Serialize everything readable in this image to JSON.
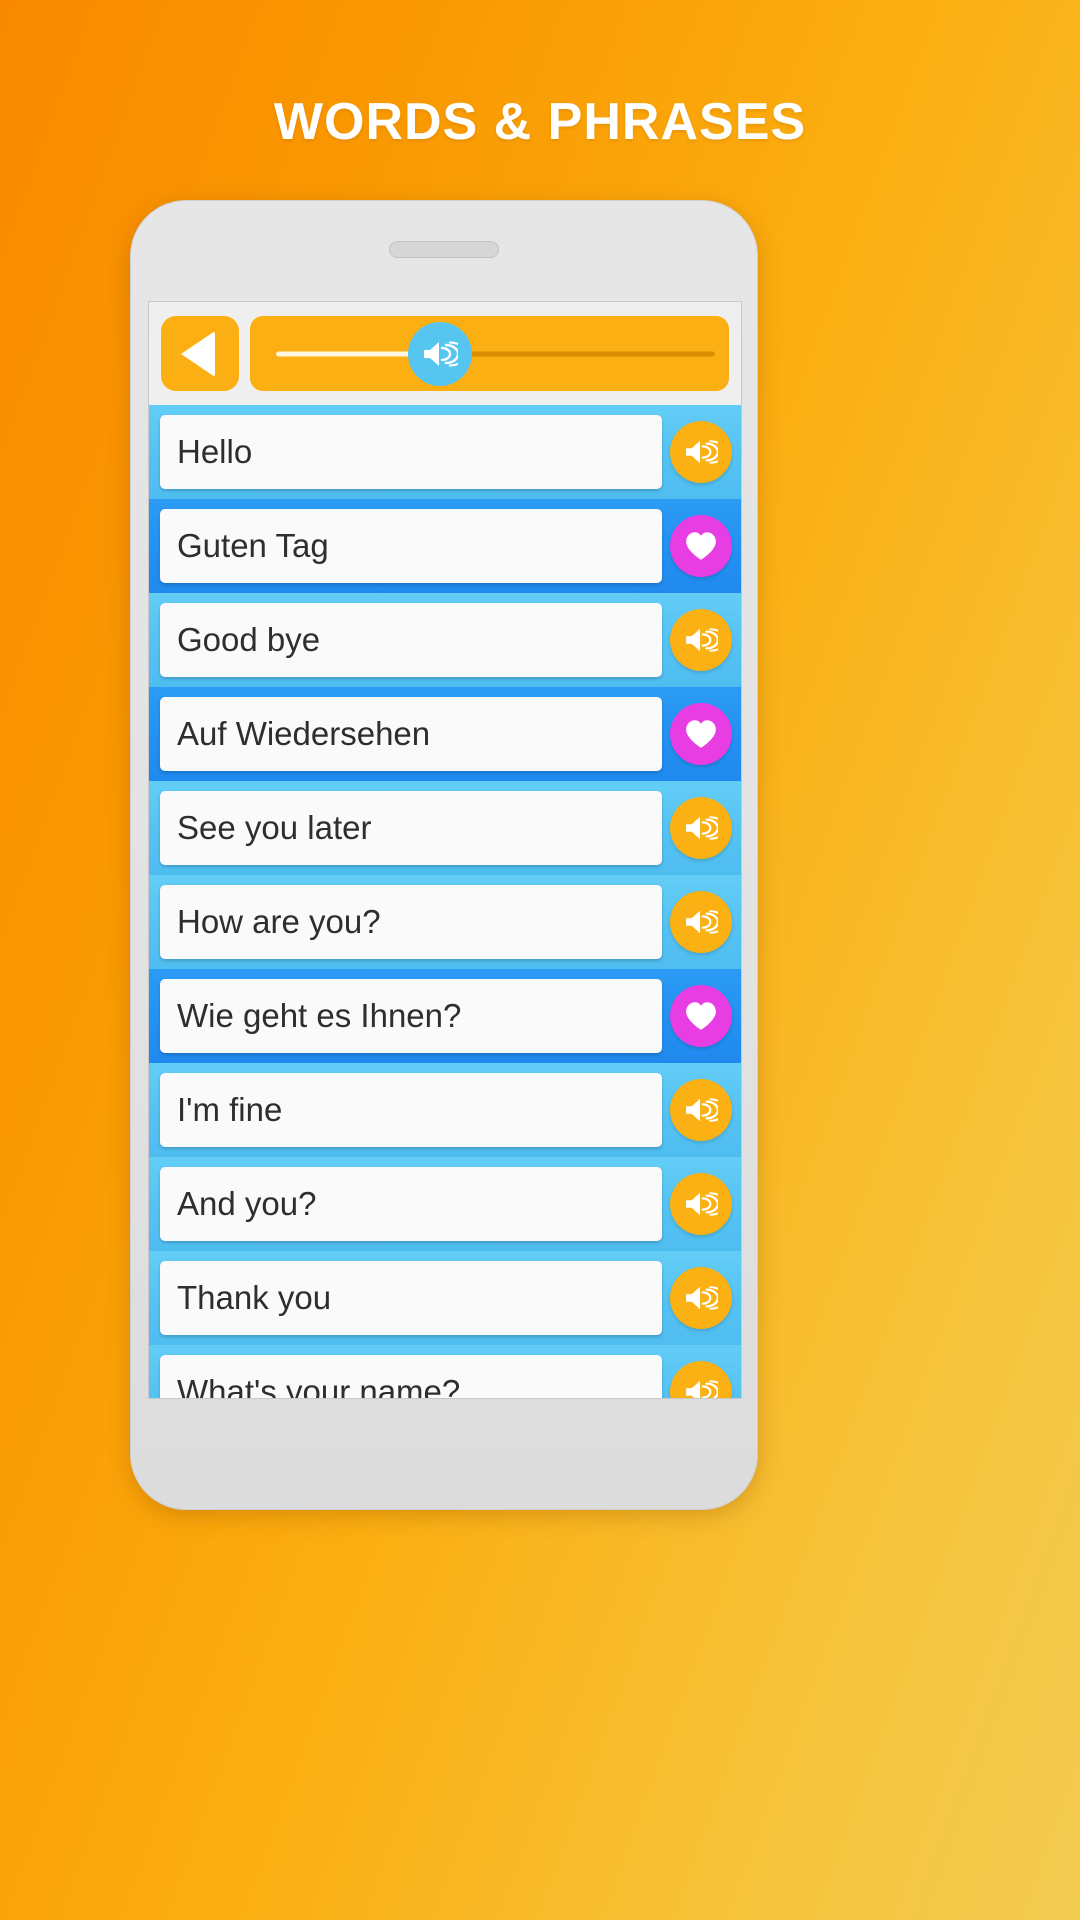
{
  "header": {
    "title": "WORDS & PHRASES"
  },
  "device": {
    "speaker_grille": "speaker-grille",
    "frame_color": "#e3e3e3"
  },
  "toolbar": {
    "back_button": {
      "label": "Back",
      "icon": "back-triangle-icon",
      "color": "#FCAF12"
    },
    "volume_slider": {
      "icon": "speaker-icon",
      "thumb_color": "#56C5F0",
      "track_color": "#FCAF12",
      "value_percent": 30
    }
  },
  "colors": {
    "background_start": "#F98A00",
    "background_end": "#F3CC52",
    "row_english": "#54C2F2",
    "row_german": "#2391F2",
    "speak_button": "#FBB014",
    "favorite_button": "#E83DE2",
    "card": "#FAFAFA",
    "text": "#2e2e2e"
  },
  "list": {
    "rows": [
      {
        "text": "Hello",
        "lang": "en",
        "action": "speak",
        "icon": "speaker-icon"
      },
      {
        "text": "Guten Tag",
        "lang": "de",
        "action": "favorite",
        "icon": "heart-icon"
      },
      {
        "text": "Good bye",
        "lang": "en",
        "action": "speak",
        "icon": "speaker-icon"
      },
      {
        "text": "Auf Wiedersehen",
        "lang": "de",
        "action": "favorite",
        "icon": "heart-icon"
      },
      {
        "text": "See you later",
        "lang": "en",
        "action": "speak",
        "icon": "speaker-icon"
      },
      {
        "text": "How are you?",
        "lang": "en",
        "action": "speak",
        "icon": "speaker-icon"
      },
      {
        "text": "Wie geht es Ihnen?",
        "lang": "de",
        "action": "favorite",
        "icon": "heart-icon"
      },
      {
        "text": "I'm fine",
        "lang": "en",
        "action": "speak",
        "icon": "speaker-icon"
      },
      {
        "text": "And you?",
        "lang": "en",
        "action": "speak",
        "icon": "speaker-icon"
      },
      {
        "text": "Thank you",
        "lang": "en",
        "action": "speak",
        "icon": "speaker-icon"
      },
      {
        "text": "What's your name?",
        "lang": "en",
        "action": "speak",
        "icon": "speaker-icon"
      }
    ]
  }
}
